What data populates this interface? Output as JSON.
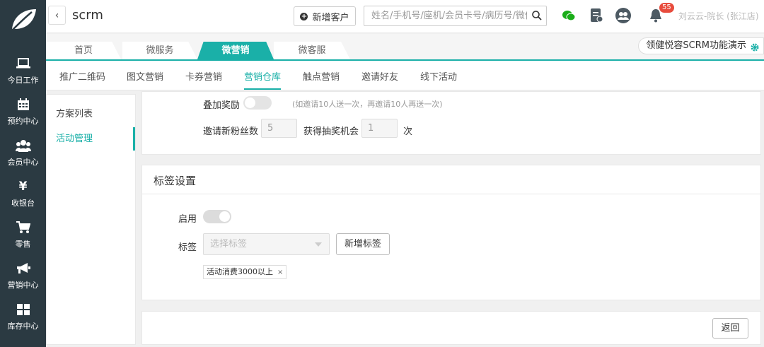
{
  "header": {
    "app_title": "scrm",
    "add_customer_label": "新增客户",
    "search_placeholder": "姓名/手机号/座机/会员卡号/病历号/微信号",
    "notification_count": "55",
    "user_name": "刘云云-院长 (张江店)"
  },
  "sidebar": {
    "items": [
      {
        "label": "今日工作",
        "icon": "laptop-icon"
      },
      {
        "label": "预约中心",
        "icon": "calendar-icon"
      },
      {
        "label": "会员中心",
        "icon": "users-icon"
      },
      {
        "label": "收银台",
        "icon": "yen-icon"
      },
      {
        "label": "零售",
        "icon": "cart-icon"
      },
      {
        "label": "营销中心",
        "icon": "megaphone-icon"
      },
      {
        "label": "库存中心",
        "icon": "grid-icon"
      }
    ]
  },
  "module_tabs": [
    "首页",
    "微服务",
    "微营销",
    "微客服"
  ],
  "demo_button": "领健悦容SCRM功能演示",
  "sub_tabs": [
    "推广二维码",
    "图文营销",
    "卡券营销",
    "营销仓库",
    "触点营销",
    "邀请好友",
    "线下活动"
  ],
  "sub_nav": [
    "方案列表",
    "活动管理"
  ],
  "reward": {
    "stack_label": "叠加奖励",
    "stack_hint": "(如邀请10人送一次，再邀请10人再送一次)",
    "invite_label": "邀请新粉丝数",
    "invite_value": "5",
    "chance_label": "获得抽奖机会",
    "chance_value": "1",
    "unit": "次"
  },
  "tag_settings": {
    "title": "标签设置",
    "enable_label": "启用",
    "tag_label": "标签",
    "select_placeholder": "选择标签",
    "add_tag_button": "新增标签",
    "selected_tag": "活动消费3000以上",
    "remove_glyph": "×"
  },
  "footer": {
    "back_button": "返回"
  },
  "colors": {
    "accent": "#1ab0a8",
    "sidebar_bg": "#2b3a42",
    "badge": "#e84c3d"
  }
}
